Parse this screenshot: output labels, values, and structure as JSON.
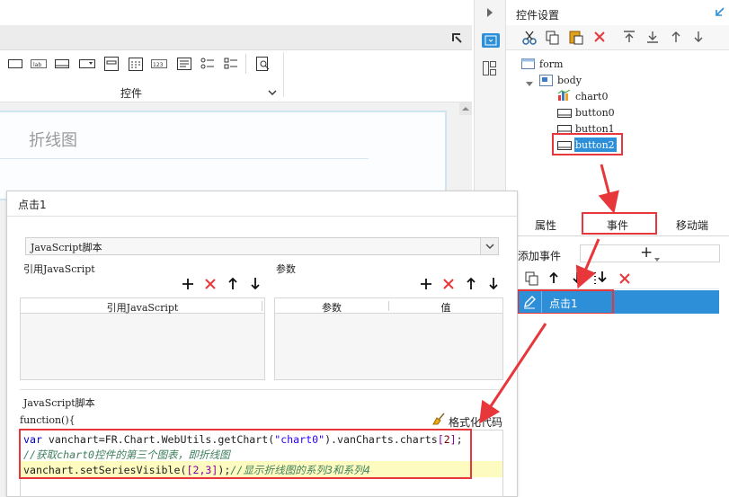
{
  "designer": {
    "widgets_label": "控件",
    "chart_title": "折线图"
  },
  "right_panel": {
    "title": "控件设置",
    "tree": {
      "form": "form",
      "body": "body",
      "children": [
        "chart0",
        "button0",
        "button1",
        "button2"
      ]
    },
    "tabs": [
      "属性",
      "事件",
      "移动端"
    ],
    "add_event_label": "添加事件",
    "add_event_button": "+",
    "event_item": "点击1"
  },
  "dialog": {
    "title": "点击1",
    "script_type": "JavaScript脚本",
    "ref_js_label": "引用JavaScript",
    "params_label": "参数",
    "ref_js_col": "引用JavaScript",
    "params_col": "参数",
    "value_col": "值",
    "js_section_label": "JavaScript脚本",
    "function_header": "function(){",
    "format_button": "格式化代码",
    "code": {
      "line1_kw": "var",
      "line1_a": " vanchart=FR.Chart.WebUtils.getChart(",
      "line1_str": "\"chart0\"",
      "line1_b": ").vanCharts.charts",
      "line1_br_open": "[",
      "line1_num": "2",
      "line1_br_close": "]",
      "line1_end": ";",
      "line2_cmt": "//获取chart0控件的第三个图表，即折线图",
      "line3_a": "vanchart.setSeriesVisible(",
      "line3_br": "[2,3]",
      "line3_b": ");",
      "line3_cmt": "//显示折线图的系列3和系列4"
    }
  },
  "colors": {
    "accent": "#2d8fd8",
    "highlight_box": "#e8373b",
    "code_highlight": "#fefbc0"
  }
}
